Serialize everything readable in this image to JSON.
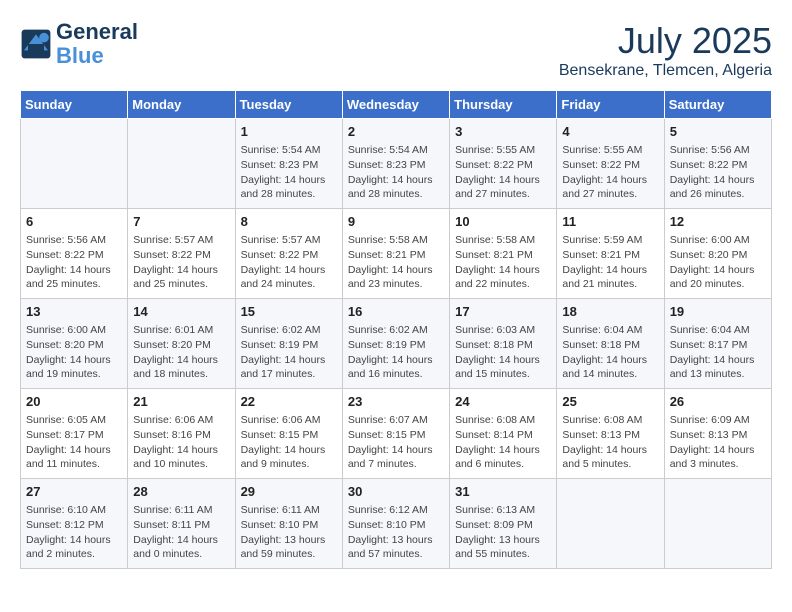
{
  "logo": {
    "line1": "General",
    "line2": "Blue"
  },
  "title": "July 2025",
  "location": "Bensekrane, Tlemcen, Algeria",
  "headers": [
    "Sunday",
    "Monday",
    "Tuesday",
    "Wednesday",
    "Thursday",
    "Friday",
    "Saturday"
  ],
  "weeks": [
    [
      {
        "day": "",
        "info": ""
      },
      {
        "day": "",
        "info": ""
      },
      {
        "day": "1",
        "sunrise": "5:54 AM",
        "sunset": "8:23 PM",
        "daylight": "14 hours and 28 minutes."
      },
      {
        "day": "2",
        "sunrise": "5:54 AM",
        "sunset": "8:23 PM",
        "daylight": "14 hours and 28 minutes."
      },
      {
        "day": "3",
        "sunrise": "5:55 AM",
        "sunset": "8:22 PM",
        "daylight": "14 hours and 27 minutes."
      },
      {
        "day": "4",
        "sunrise": "5:55 AM",
        "sunset": "8:22 PM",
        "daylight": "14 hours and 27 minutes."
      },
      {
        "day": "5",
        "sunrise": "5:56 AM",
        "sunset": "8:22 PM",
        "daylight": "14 hours and 26 minutes."
      }
    ],
    [
      {
        "day": "6",
        "sunrise": "5:56 AM",
        "sunset": "8:22 PM",
        "daylight": "14 hours and 25 minutes."
      },
      {
        "day": "7",
        "sunrise": "5:57 AM",
        "sunset": "8:22 PM",
        "daylight": "14 hours and 25 minutes."
      },
      {
        "day": "8",
        "sunrise": "5:57 AM",
        "sunset": "8:22 PM",
        "daylight": "14 hours and 24 minutes."
      },
      {
        "day": "9",
        "sunrise": "5:58 AM",
        "sunset": "8:21 PM",
        "daylight": "14 hours and 23 minutes."
      },
      {
        "day": "10",
        "sunrise": "5:58 AM",
        "sunset": "8:21 PM",
        "daylight": "14 hours and 22 minutes."
      },
      {
        "day": "11",
        "sunrise": "5:59 AM",
        "sunset": "8:21 PM",
        "daylight": "14 hours and 21 minutes."
      },
      {
        "day": "12",
        "sunrise": "6:00 AM",
        "sunset": "8:20 PM",
        "daylight": "14 hours and 20 minutes."
      }
    ],
    [
      {
        "day": "13",
        "sunrise": "6:00 AM",
        "sunset": "8:20 PM",
        "daylight": "14 hours and 19 minutes."
      },
      {
        "day": "14",
        "sunrise": "6:01 AM",
        "sunset": "8:20 PM",
        "daylight": "14 hours and 18 minutes."
      },
      {
        "day": "15",
        "sunrise": "6:02 AM",
        "sunset": "8:19 PM",
        "daylight": "14 hours and 17 minutes."
      },
      {
        "day": "16",
        "sunrise": "6:02 AM",
        "sunset": "8:19 PM",
        "daylight": "14 hours and 16 minutes."
      },
      {
        "day": "17",
        "sunrise": "6:03 AM",
        "sunset": "8:18 PM",
        "daylight": "14 hours and 15 minutes."
      },
      {
        "day": "18",
        "sunrise": "6:04 AM",
        "sunset": "8:18 PM",
        "daylight": "14 hours and 14 minutes."
      },
      {
        "day": "19",
        "sunrise": "6:04 AM",
        "sunset": "8:17 PM",
        "daylight": "14 hours and 13 minutes."
      }
    ],
    [
      {
        "day": "20",
        "sunrise": "6:05 AM",
        "sunset": "8:17 PM",
        "daylight": "14 hours and 11 minutes."
      },
      {
        "day": "21",
        "sunrise": "6:06 AM",
        "sunset": "8:16 PM",
        "daylight": "14 hours and 10 minutes."
      },
      {
        "day": "22",
        "sunrise": "6:06 AM",
        "sunset": "8:15 PM",
        "daylight": "14 hours and 9 minutes."
      },
      {
        "day": "23",
        "sunrise": "6:07 AM",
        "sunset": "8:15 PM",
        "daylight": "14 hours and 7 minutes."
      },
      {
        "day": "24",
        "sunrise": "6:08 AM",
        "sunset": "8:14 PM",
        "daylight": "14 hours and 6 minutes."
      },
      {
        "day": "25",
        "sunrise": "6:08 AM",
        "sunset": "8:13 PM",
        "daylight": "14 hours and 5 minutes."
      },
      {
        "day": "26",
        "sunrise": "6:09 AM",
        "sunset": "8:13 PM",
        "daylight": "14 hours and 3 minutes."
      }
    ],
    [
      {
        "day": "27",
        "sunrise": "6:10 AM",
        "sunset": "8:12 PM",
        "daylight": "14 hours and 2 minutes."
      },
      {
        "day": "28",
        "sunrise": "6:11 AM",
        "sunset": "8:11 PM",
        "daylight": "14 hours and 0 minutes."
      },
      {
        "day": "29",
        "sunrise": "6:11 AM",
        "sunset": "8:10 PM",
        "daylight": "13 hours and 59 minutes."
      },
      {
        "day": "30",
        "sunrise": "6:12 AM",
        "sunset": "8:10 PM",
        "daylight": "13 hours and 57 minutes."
      },
      {
        "day": "31",
        "sunrise": "6:13 AM",
        "sunset": "8:09 PM",
        "daylight": "13 hours and 55 minutes."
      },
      {
        "day": "",
        "info": ""
      },
      {
        "day": "",
        "info": ""
      }
    ]
  ],
  "labels": {
    "sunrise": "Sunrise: ",
    "sunset": "Sunset: ",
    "daylight": "Daylight: "
  }
}
